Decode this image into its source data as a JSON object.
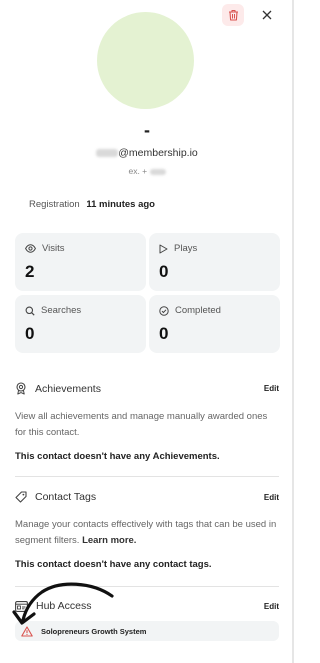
{
  "header": {
    "delete_icon": "trash-icon",
    "close_icon": "close-icon",
    "delete_color": "#d9534f"
  },
  "contact": {
    "avatar_color": "#e4f2d2",
    "name": "-",
    "email": "@membership.io",
    "phone_prefix": "ex. +"
  },
  "registration": {
    "label": "Registration",
    "value": "11 minutes ago"
  },
  "stats": [
    {
      "label": "Visits",
      "value": "2",
      "icon": "eye-icon"
    },
    {
      "label": "Plays",
      "value": "0",
      "icon": "play-icon"
    },
    {
      "label": "Searches",
      "value": "0",
      "icon": "search-icon"
    },
    {
      "label": "Completed",
      "value": "0",
      "icon": "check-circle-icon"
    }
  ],
  "achievements": {
    "title": "Achievements",
    "edit_label": "Edit",
    "description": "View all achievements and manage manually awarded ones for this contact.",
    "empty": "This contact doesn't have any Achievements."
  },
  "tags": {
    "title": "Contact Tags",
    "edit_label": "Edit",
    "description": "Manage your contacts effectively with tags that can be used in segment filters.",
    "learn_more": "Learn more.",
    "empty": "This contact doesn't have any contact tags."
  },
  "hub_access": {
    "title": "Hub Access",
    "edit_label": "Edit",
    "items": [
      {
        "name": "Solopreneurs Growth System",
        "icon": "warning-icon",
        "icon_color": "#d9534f"
      }
    ]
  }
}
